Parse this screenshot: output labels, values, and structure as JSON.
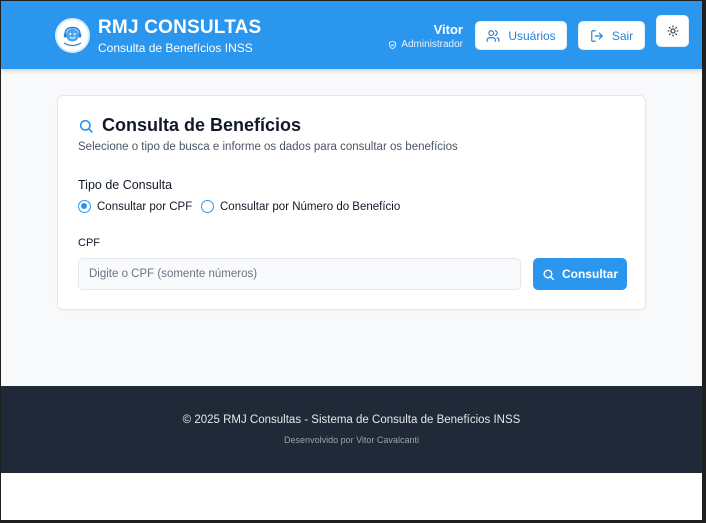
{
  "header": {
    "logo_icon": "rmj-call-center-logo",
    "title": "RMJ CONSULTAS",
    "subtitle": "Consulta de Benefícios INSS",
    "user": {
      "name": "Vitor",
      "role": "Administrador",
      "role_icon": "shield-check-icon"
    },
    "buttons": {
      "users_label": "Usuários",
      "users_icon": "users-icon",
      "logout_label": "Sair",
      "logout_icon": "logout-icon",
      "theme_icon": "sun-icon"
    }
  },
  "search": {
    "title": "Consulta de Benefícios",
    "title_icon": "search-icon",
    "description": "Selecione o tipo de busca e informe os dados para consultar os benefícios",
    "type_label": "Tipo de Consulta",
    "options": [
      {
        "label": "Consultar por CPF",
        "selected": true
      },
      {
        "label": "Consultar por Número do Benefício",
        "selected": false
      }
    ],
    "field_label": "CPF",
    "field_value": "",
    "field_placeholder": "Digite o CPF (somente números)",
    "submit_label": "Consultar",
    "submit_icon": "search-icon"
  },
  "footer": {
    "copyright": "© 2025 RMJ Consultas - Sistema de Consulta de Benefícios INSS",
    "developer": "Desenvolvido por Vitor Cavalcanti"
  },
  "colors": {
    "primary": "#2b96ee",
    "footer_bg": "#1f2937",
    "page_bg": "#f8f9fa"
  }
}
